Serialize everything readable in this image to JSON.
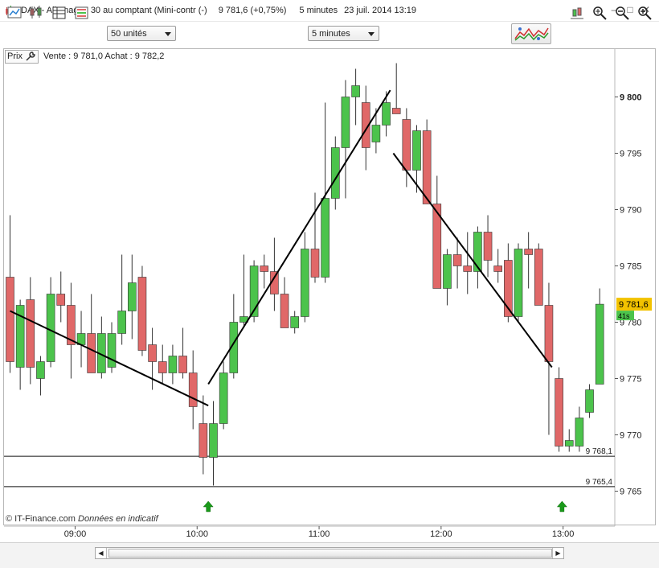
{
  "window": {
    "title": "DAX - Allemagne 30 au comptant (Mini-contr (-)",
    "price_change": "9 781,6 (+0,75%)",
    "period": "5 minutes",
    "datetime": "23 juil. 2014 13:19",
    "minimize": "–",
    "restore": "□",
    "close": "✕"
  },
  "toolbar": {
    "units_select": "50 unités",
    "period_select": "5 minutes",
    "indicator_button_icon": "indicators-icon"
  },
  "infobar": {
    "prix_label": "Prix",
    "quote": "Vente : 9 781,0 Achat : 9 782,2"
  },
  "footer": {
    "copyright": "© IT-Finance.com",
    "disclaimer": "Données en indicatif"
  },
  "colors": {
    "up": "#4cc34c",
    "down": "#e06868",
    "price_tag": "#f2c200",
    "arrow": "#1a9a1a"
  },
  "chart_data": {
    "type": "candlestick",
    "y_ticks": [
      "9 800",
      "9 795",
      "9 790",
      "9 785",
      "9 780",
      "9 775",
      "9 770",
      "9 765"
    ],
    "y_tick_values": [
      9800,
      9795,
      9790,
      9785,
      9780,
      9775,
      9770,
      9765
    ],
    "ylim": [
      9763,
      9803
    ],
    "x_ticks": [
      "09:00",
      "10:00",
      "11:00",
      "12:00",
      "13:00"
    ],
    "x_tick_index": [
      6.4,
      18.4,
      30.4,
      42.4,
      54.4
    ],
    "last_price_label": "9 781,6",
    "last_price": 9781.6,
    "timer_label": "41s",
    "hlines": [
      {
        "label": "9 768,1",
        "value": 9768.1
      },
      {
        "label": "9 765,4",
        "value": 9765.4
      }
    ],
    "trendlines": [
      {
        "from": [
          0,
          9781.0
        ],
        "to": [
          19.5,
          9772.6
        ]
      },
      {
        "from": [
          19.5,
          9774.5
        ],
        "to": [
          37.4,
          9800.6
        ]
      },
      {
        "from": [
          37.7,
          9795.0
        ],
        "to": [
          53.3,
          9776.0
        ]
      }
    ],
    "signal_arrows_index": [
      19.5,
      54.3
    ],
    "candles": [
      [
        9784.0,
        9789.5,
        9775.5,
        9776.5
      ],
      [
        9776.0,
        9782.0,
        9774.0,
        9781.5
      ],
      [
        9782.0,
        9784.0,
        9774.5,
        9776.0
      ],
      [
        9775.0,
        9777.0,
        9773.5,
        9776.5
      ],
      [
        9776.5,
        9784.0,
        9776.0,
        9782.5
      ],
      [
        9782.5,
        9784.5,
        9780.0,
        9781.5
      ],
      [
        9781.5,
        9783.5,
        9775.0,
        9778.0
      ],
      [
        9778.0,
        9781.0,
        9776.0,
        9779.0
      ],
      [
        9779.0,
        9782.5,
        9775.5,
        9775.5
      ],
      [
        9775.5,
        9780.5,
        9775.0,
        9779.0
      ],
      [
        9776.0,
        9780.0,
        9775.5,
        9779.0
      ],
      [
        9779.0,
        9786.0,
        9778.0,
        9781.0
      ],
      [
        9781.0,
        9786.0,
        9778.5,
        9783.5
      ],
      [
        9784.0,
        9785.0,
        9777.0,
        9777.5
      ],
      [
        9778.0,
        9779.5,
        9774.0,
        9776.5
      ],
      [
        9776.5,
        9778.0,
        9774.5,
        9775.5
      ],
      [
        9775.5,
        9778.0,
        9774.5,
        9777.0
      ],
      [
        9777.0,
        9779.5,
        9775.0,
        9775.5
      ],
      [
        9775.5,
        9777.5,
        9770.5,
        9772.5
      ],
      [
        9771.0,
        9773.5,
        9766.5,
        9768.0
      ],
      [
        9768.0,
        9773.0,
        9765.5,
        9771.0
      ],
      [
        9771.0,
        9776.5,
        9770.5,
        9775.5
      ],
      [
        9775.5,
        9782.5,
        9775.0,
        9780.0
      ],
      [
        9780.0,
        9786.0,
        9779.5,
        9780.5
      ],
      [
        9780.5,
        9785.5,
        9780.0,
        9785.0
      ],
      [
        9785.0,
        9786.0,
        9783.0,
        9784.5
      ],
      [
        9784.5,
        9787.5,
        9781.0,
        9782.5
      ],
      [
        9782.5,
        9784.0,
        9779.5,
        9779.5
      ],
      [
        9779.5,
        9781.0,
        9779.0,
        9780.5
      ],
      [
        9780.5,
        9788.0,
        9780.0,
        9786.5
      ],
      [
        9786.5,
        9791.5,
        9783.5,
        9784.0
      ],
      [
        9784.0,
        9799.5,
        9783.5,
        9791.0
      ],
      [
        9791.0,
        9796.5,
        9790.0,
        9795.5
      ],
      [
        9795.5,
        9801.5,
        9791.0,
        9800.0
      ],
      [
        9800.0,
        9802.5,
        9797.5,
        9801.0
      ],
      [
        9799.5,
        9801.0,
        9793.5,
        9795.5
      ],
      [
        9796.0,
        9799.0,
        9795.0,
        9797.5
      ],
      [
        9797.5,
        9800.5,
        9796.5,
        9799.5
      ],
      [
        9799.0,
        9803.0,
        9798.5,
        9798.5
      ],
      [
        9798.0,
        9799.0,
        9792.0,
        9793.5
      ],
      [
        9793.5,
        9797.5,
        9791.5,
        9797.0
      ],
      [
        9797.0,
        9798.0,
        9790.5,
        9790.5
      ],
      [
        9790.5,
        9793.0,
        9783.5,
        9783.0
      ],
      [
        9783.0,
        9786.5,
        9781.5,
        9786.0
      ],
      [
        9786.0,
        9787.5,
        9783.0,
        9785.0
      ],
      [
        9785.0,
        9788.0,
        9782.5,
        9784.5
      ],
      [
        9784.5,
        9788.5,
        9783.0,
        9788.0
      ],
      [
        9788.0,
        9789.5,
        9784.0,
        9785.5
      ],
      [
        9785.0,
        9786.5,
        9783.5,
        9784.5
      ],
      [
        9785.5,
        9787.0,
        9780.0,
        9780.5
      ],
      [
        9780.5,
        9787.0,
        9780.0,
        9786.5
      ],
      [
        9786.5,
        9788.0,
        9783.0,
        9786.0
      ],
      [
        9786.5,
        9787.0,
        9781.5,
        9781.5
      ],
      [
        9781.5,
        9783.5,
        9770.0,
        9776.5
      ],
      [
        9775.0,
        9776.0,
        9768.5,
        9769.0
      ],
      [
        9769.0,
        9770.5,
        9768.5,
        9769.5
      ],
      [
        9769.0,
        9772.5,
        9768.5,
        9771.5
      ],
      [
        9772.0,
        9774.5,
        9771.5,
        9774.0
      ],
      [
        9774.5,
        9783.0,
        9774.5,
        9781.6
      ]
    ]
  }
}
